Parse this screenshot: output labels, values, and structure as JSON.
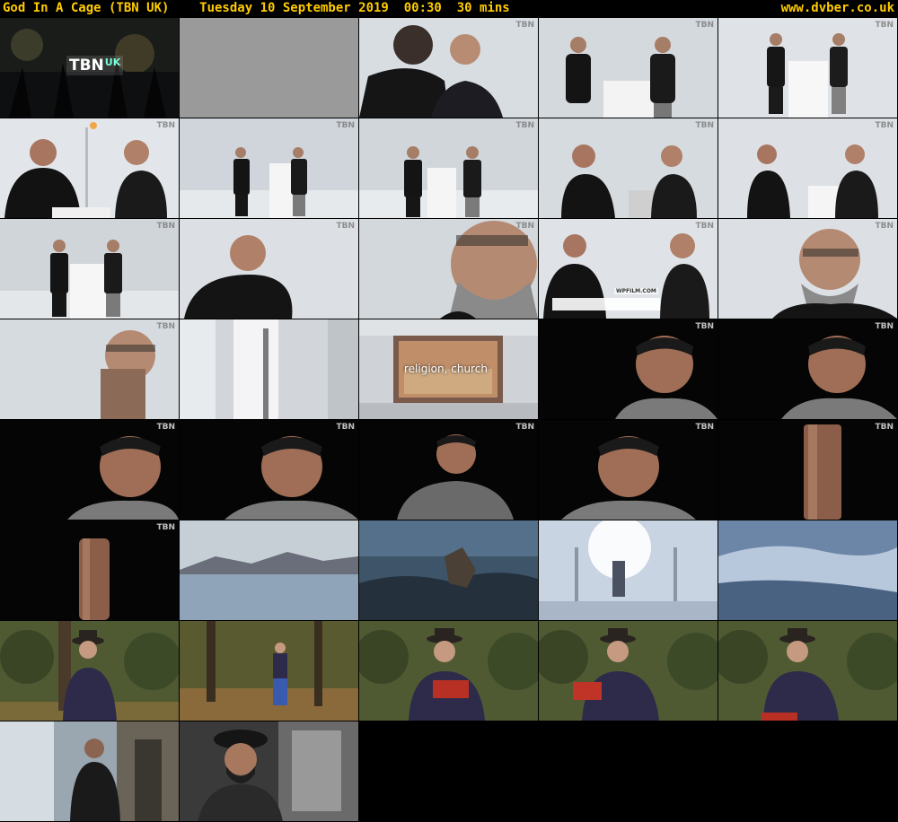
{
  "header": {
    "title": "God In A Cage (TBN UK)    Tuesday 10 September 2019  00:30  30 mins",
    "site": "www.dvber.co.uk"
  },
  "thumbs": {
    "logo": "TBN",
    "intro_logo": "TBN",
    "intro_logo_suffix": "UK",
    "caption_religion": "religion, church",
    "caption_wpfilm": "WPFILM.COM"
  },
  "colors": {
    "header_text": "#ffcc00",
    "background": "#000000"
  }
}
